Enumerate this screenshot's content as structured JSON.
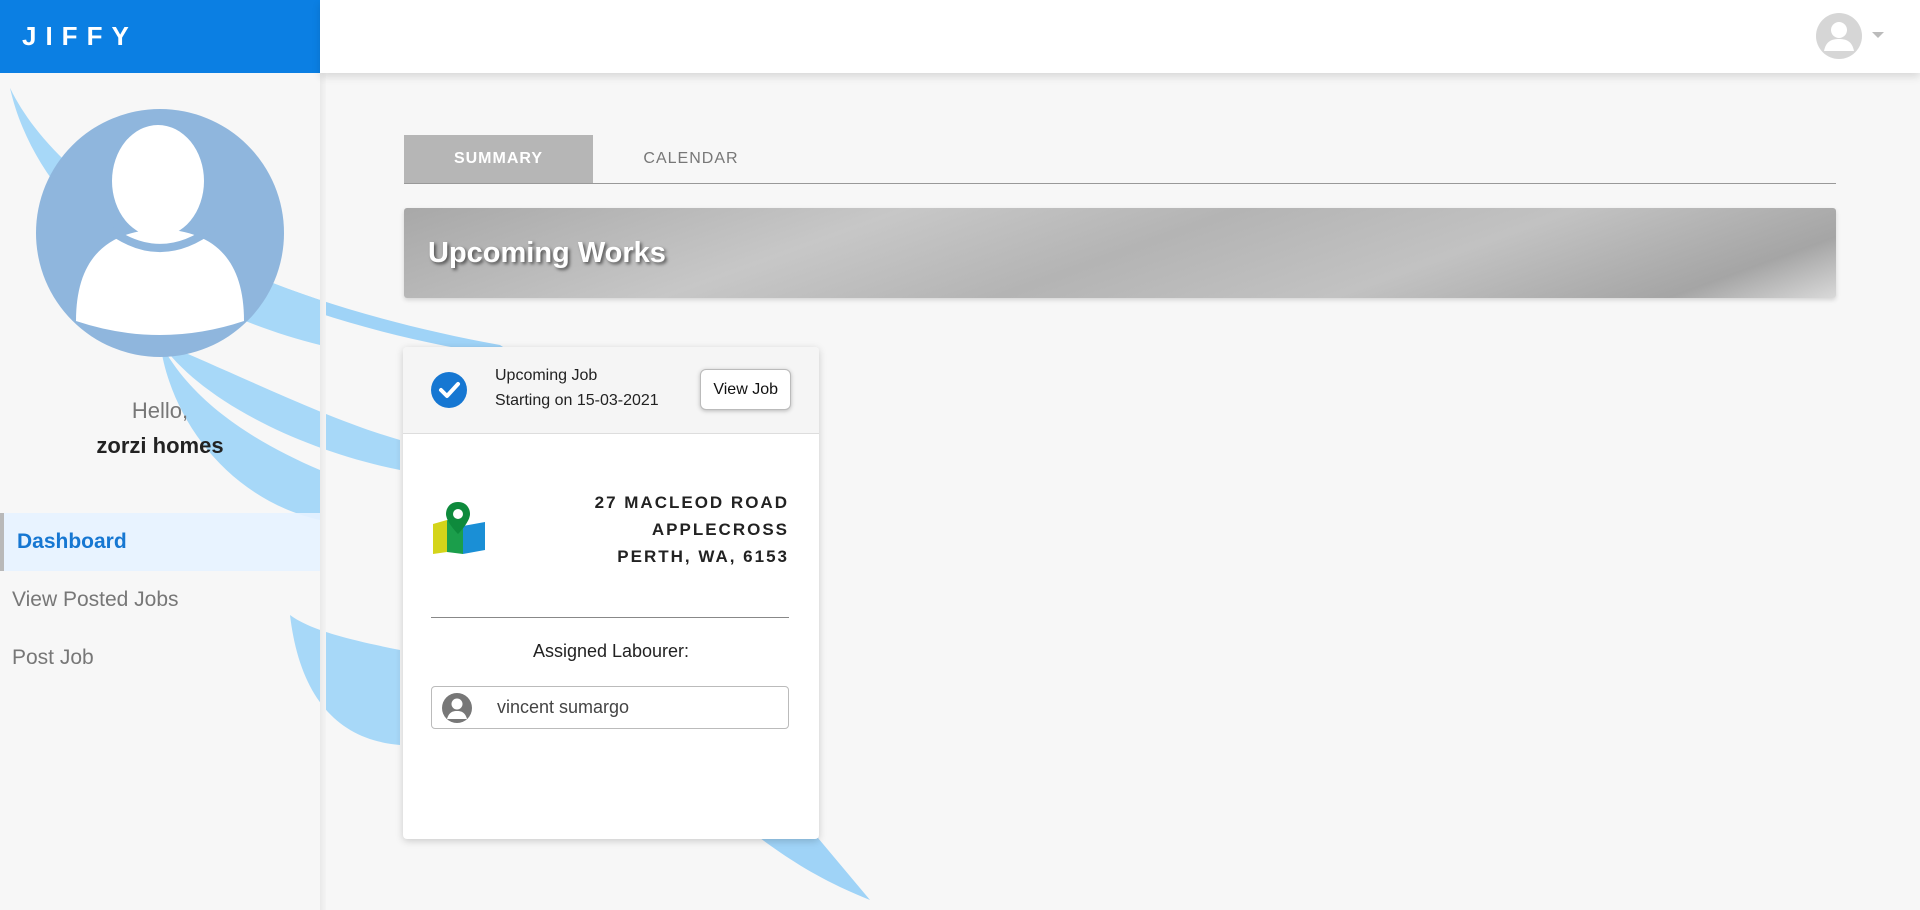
{
  "brand": {
    "name": "JIFFY",
    "color": "#0b7fe3"
  },
  "sidebar": {
    "greeting": "Hello,",
    "username": "zorzi homes",
    "items": [
      {
        "label": "Dashboard",
        "active": true
      },
      {
        "label": "View Posted Jobs",
        "active": false
      },
      {
        "label": "Post Job",
        "active": false
      }
    ]
  },
  "tabs": [
    {
      "label": "SUMMARY",
      "active": true
    },
    {
      "label": "CALENDAR",
      "active": false
    }
  ],
  "section": {
    "title": "Upcoming Works"
  },
  "job_card": {
    "title": "Upcoming Job",
    "date_text": "Starting on 15-03-2021",
    "view_button": "View Job",
    "address": {
      "line1": "27 MACLEOD ROAD",
      "line2": "APPLECROSS",
      "line3": "PERTH, WA, 6153"
    },
    "assigned_label": "Assigned Labourer:",
    "labourer_name": "vincent sumargo"
  },
  "icons": {
    "user_avatar": "user-avatar-icon",
    "check": "check-circle-icon",
    "map": "map-pin-icon",
    "caret": "caret-down-icon"
  }
}
